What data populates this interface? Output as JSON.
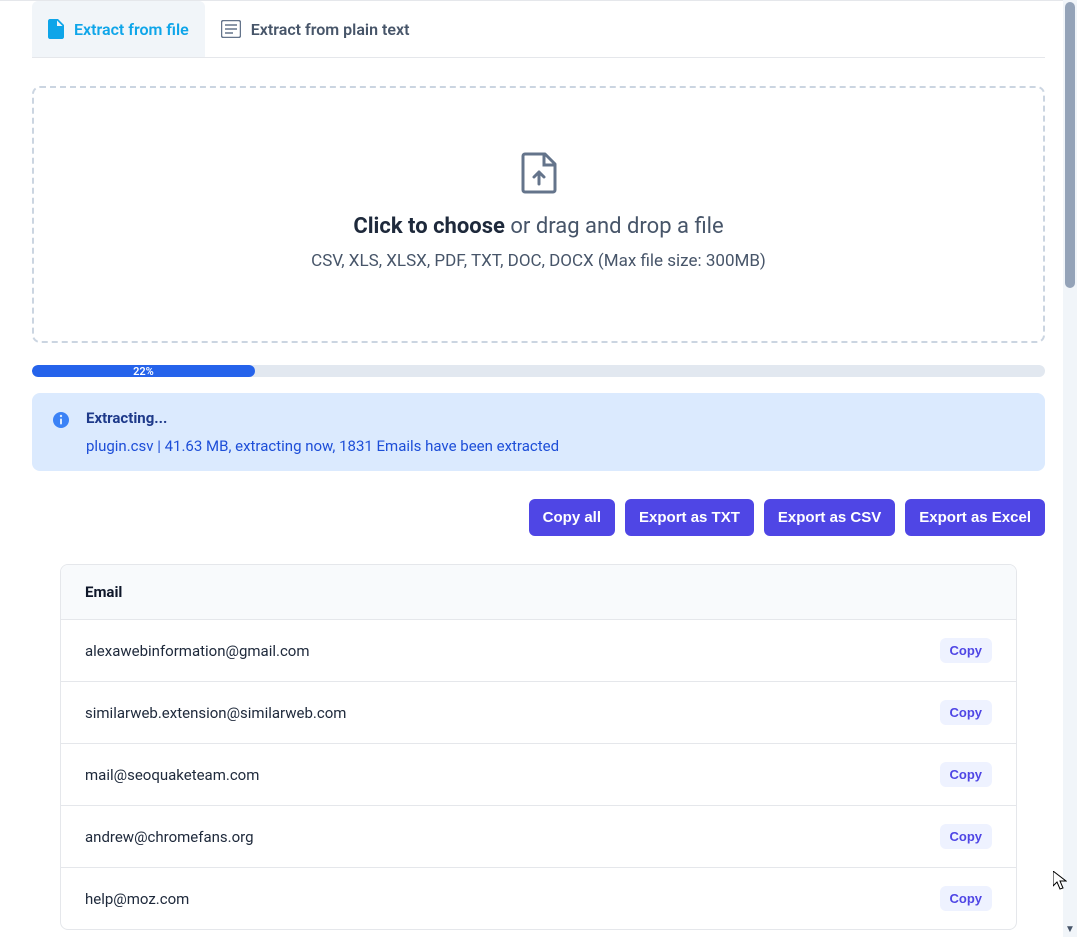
{
  "tabs": [
    {
      "label": "Extract from file",
      "active": true,
      "icon": "file-icon"
    },
    {
      "label": "Extract from plain text",
      "active": false,
      "icon": "text-icon"
    }
  ],
  "upload": {
    "bold": "Click to choose",
    "rest": " or drag and drop a file",
    "subtitle": "CSV, XLS, XLSX, PDF, TXT, DOC, DOCX (Max file size: 300MB)"
  },
  "progress": {
    "percent": "22%",
    "value": 22
  },
  "status": {
    "title": "Extracting...",
    "detail": "plugin.csv | 41.63 MB, extracting now, 1831 Emails have been extracted"
  },
  "actions": {
    "copy_all": "Copy all",
    "export_txt": "Export as TXT",
    "export_csv": "Export as CSV",
    "export_excel": "Export as Excel"
  },
  "table": {
    "header": "Email",
    "copy_label": "Copy",
    "rows": [
      {
        "email": "alexawebinformation@gmail.com"
      },
      {
        "email": "similarweb.extension@similarweb.com"
      },
      {
        "email": "mail@seoquaketeam.com"
      },
      {
        "email": "andrew@chromefans.org"
      },
      {
        "email": "help@moz.com"
      }
    ]
  }
}
